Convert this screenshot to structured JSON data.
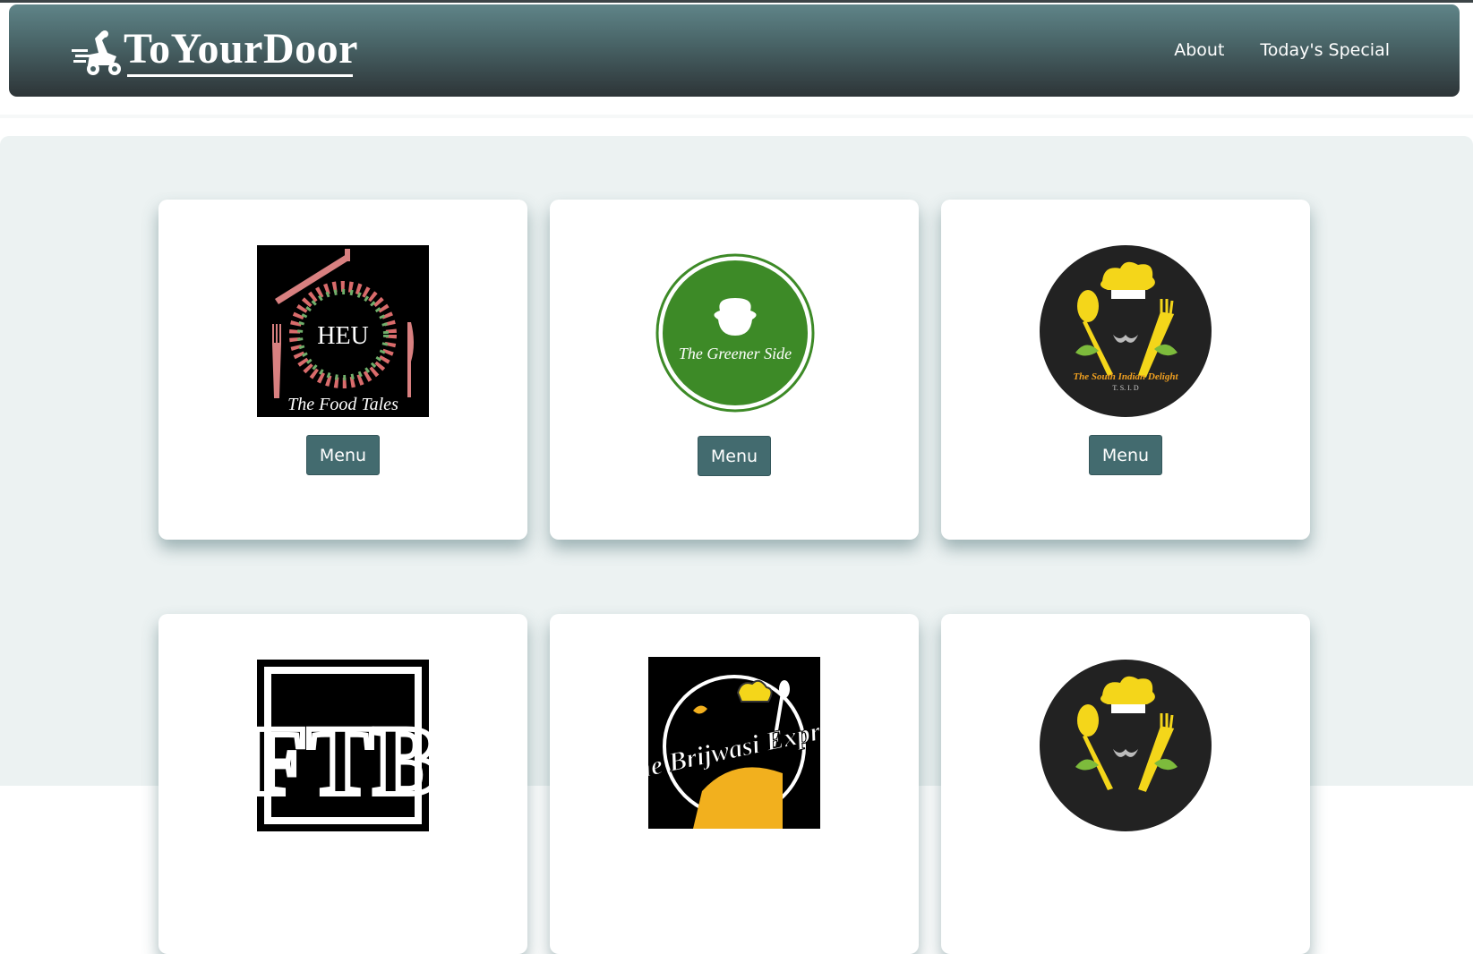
{
  "header": {
    "brand": "ToYourDoor",
    "nav": [
      {
        "label": "About"
      },
      {
        "label": "Today's Special"
      }
    ]
  },
  "restaurants": [
    {
      "logo_text": "HEU",
      "logo_caption": "The Food Tales",
      "button": "Menu",
      "icon": "food-tales-logo"
    },
    {
      "logo_caption": "The Greener Side",
      "button": "Menu",
      "icon": "greener-side-logo"
    },
    {
      "logo_caption": "The South Indian Delight",
      "logo_sub": "T. S. I. D",
      "button": "Menu",
      "icon": "south-indian-delight-logo"
    },
    {
      "logo_text": "FTB",
      "icon": "ftb-logo"
    },
    {
      "logo_caption": "The Brijwasi Express",
      "icon": "brijwasi-express-logo"
    },
    {
      "icon": "south-indian-delight-logo"
    }
  ],
  "colors": {
    "nav_top": "#5f8488",
    "nav_bottom": "#2d3437",
    "button_bg": "#436b6f",
    "page_bg": "#ecf2f2"
  }
}
